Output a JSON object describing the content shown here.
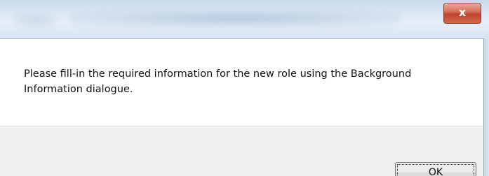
{
  "titlebar": {
    "close_glyph": "x",
    "close_icon": "close-icon"
  },
  "dialog": {
    "message": "Please fill-in the required information for the new role using the Background Information dialogue."
  },
  "footer": {
    "ok_label": "OK"
  }
}
